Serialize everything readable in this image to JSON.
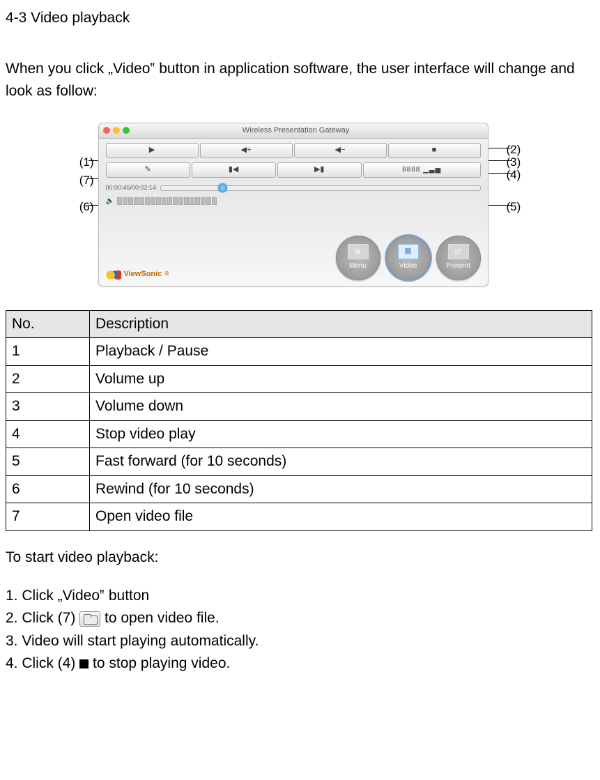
{
  "heading": "4-3 Video playback",
  "intro": "When you click „Video‟ button in application software, the user interface will change and look as follow:",
  "screenshot": {
    "window_title": "Wireless Presentation Gateway",
    "time_label": "00:00:45/00:02:14",
    "code_label": "8888",
    "row1": {
      "play": "▶",
      "volup": "◀+",
      "voldown": "◀−",
      "stop": "■"
    },
    "row2": {
      "open": "✎",
      "prev": "▮◀",
      "next": "▶▮"
    },
    "logo": "ViewSonic",
    "big": {
      "menu": "Menu",
      "video": "Video",
      "present": "Present"
    },
    "callouts": {
      "c1": "(1)",
      "c2": "(2)",
      "c3": "(3)",
      "c4": "(4)",
      "c5": "(5)",
      "c6": "(6)",
      "c7": "(7)"
    }
  },
  "table": {
    "head_no": "No.",
    "head_desc": "Description",
    "rows": [
      {
        "no": "1",
        "desc": "Playback / Pause"
      },
      {
        "no": "2",
        "desc": "Volume up"
      },
      {
        "no": "3",
        "desc": "Volume down"
      },
      {
        "no": "4",
        "desc": "Stop video play"
      },
      {
        "no": "5",
        "desc": "Fast forward (for 10 seconds)"
      },
      {
        "no": "6",
        "desc": "Rewind (for 10 seconds)"
      },
      {
        "no": "7",
        "desc": "Open video file"
      }
    ]
  },
  "start_label": "To start video playback:",
  "steps": {
    "s1": "1. Click „Video‟ button",
    "s2a": "2. Click (7) ",
    "s2b": " to open video file.",
    "s3": "3. Video will start playing automatically.",
    "s4a": "4. Click (4) ",
    "s4b": " to stop playing video."
  }
}
